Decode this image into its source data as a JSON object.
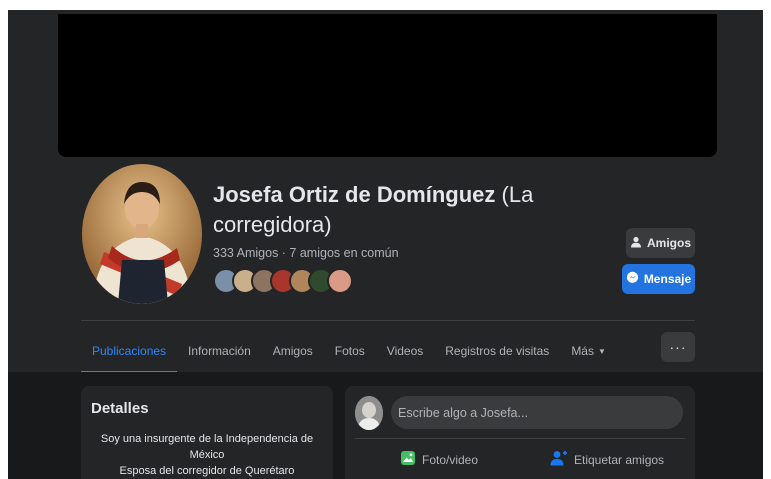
{
  "profile": {
    "name_bold": "Josefa Ortiz de Domínguez",
    "name_rest": " (La corregidora)",
    "friends_summary": "333 Amigos · 7 amigos en común"
  },
  "actions": {
    "friends_label": "Amigos",
    "message_label": "Mensaje"
  },
  "tabs": [
    {
      "label": "Publicaciones",
      "active": true
    },
    {
      "label": "Información"
    },
    {
      "label": "Amigos"
    },
    {
      "label": "Fotos"
    },
    {
      "label": "Videos"
    },
    {
      "label": "Registros de visitas"
    },
    {
      "label": "Más"
    }
  ],
  "more_button": "···",
  "details": {
    "title": "Detalles",
    "bio_lines": [
      "Soy una insurgente de la Independencia de",
      "México",
      "Esposa del corregidor de Querétaro"
    ]
  },
  "composer": {
    "placeholder": "Escribe algo a Josefa...",
    "photo_label": "Foto/video",
    "tag_label": "Etiquetar amigos"
  },
  "colors": {
    "accent": "#2d88ff",
    "message_button": "#2374e1",
    "surface": "#242526",
    "background": "#18191a"
  }
}
